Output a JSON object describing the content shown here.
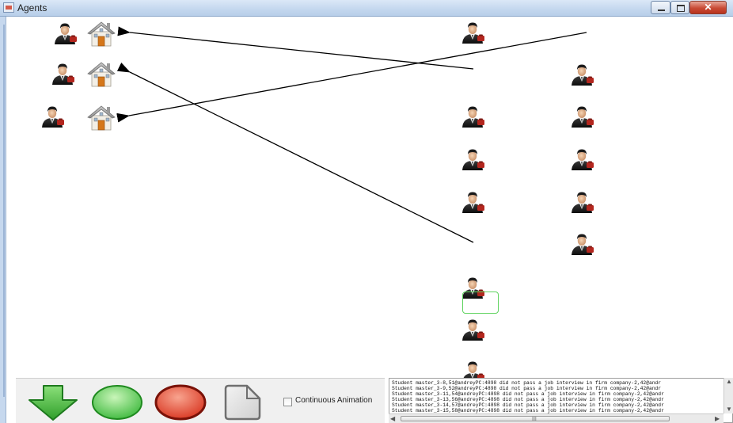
{
  "window": {
    "title": "Agents",
    "close_label": "✕"
  },
  "icons": {
    "agent": "student-agent-icon",
    "house": "company-house-icon"
  },
  "toolbar": {
    "continuous_animation_label": "Continuous Animation",
    "continuous_animation_checked": false
  },
  "log": {
    "lines": [
      "Student master_3-8,51@andreyPC:4898 did not pass a job interview in firm company-2,42@andr",
      "Student master_3-9,52@andreyPC:4898 did not pass a job interview in firm company-2,42@andr",
      "Student master_3-11,54@andreyPC:4898 did not pass a job interview in firm company-2,42@andr",
      "Student master_3-13,56@andreyPC:4898 did not pass a job interview in firm company-2,42@andr",
      "Student master_3-14,57@andreyPC:4898 did not pass a job interview in firm company-2,42@andr",
      "Student master_3-15,58@andreyPC:4898 did not pass a job interview in firm company-2,42@andr"
    ],
    "hscroll_grip": "III"
  },
  "colors": {
    "arrow": "#000000",
    "selection": "#5fd35f",
    "go_green": "#3cb83c",
    "stop_red": "#d8341f"
  }
}
